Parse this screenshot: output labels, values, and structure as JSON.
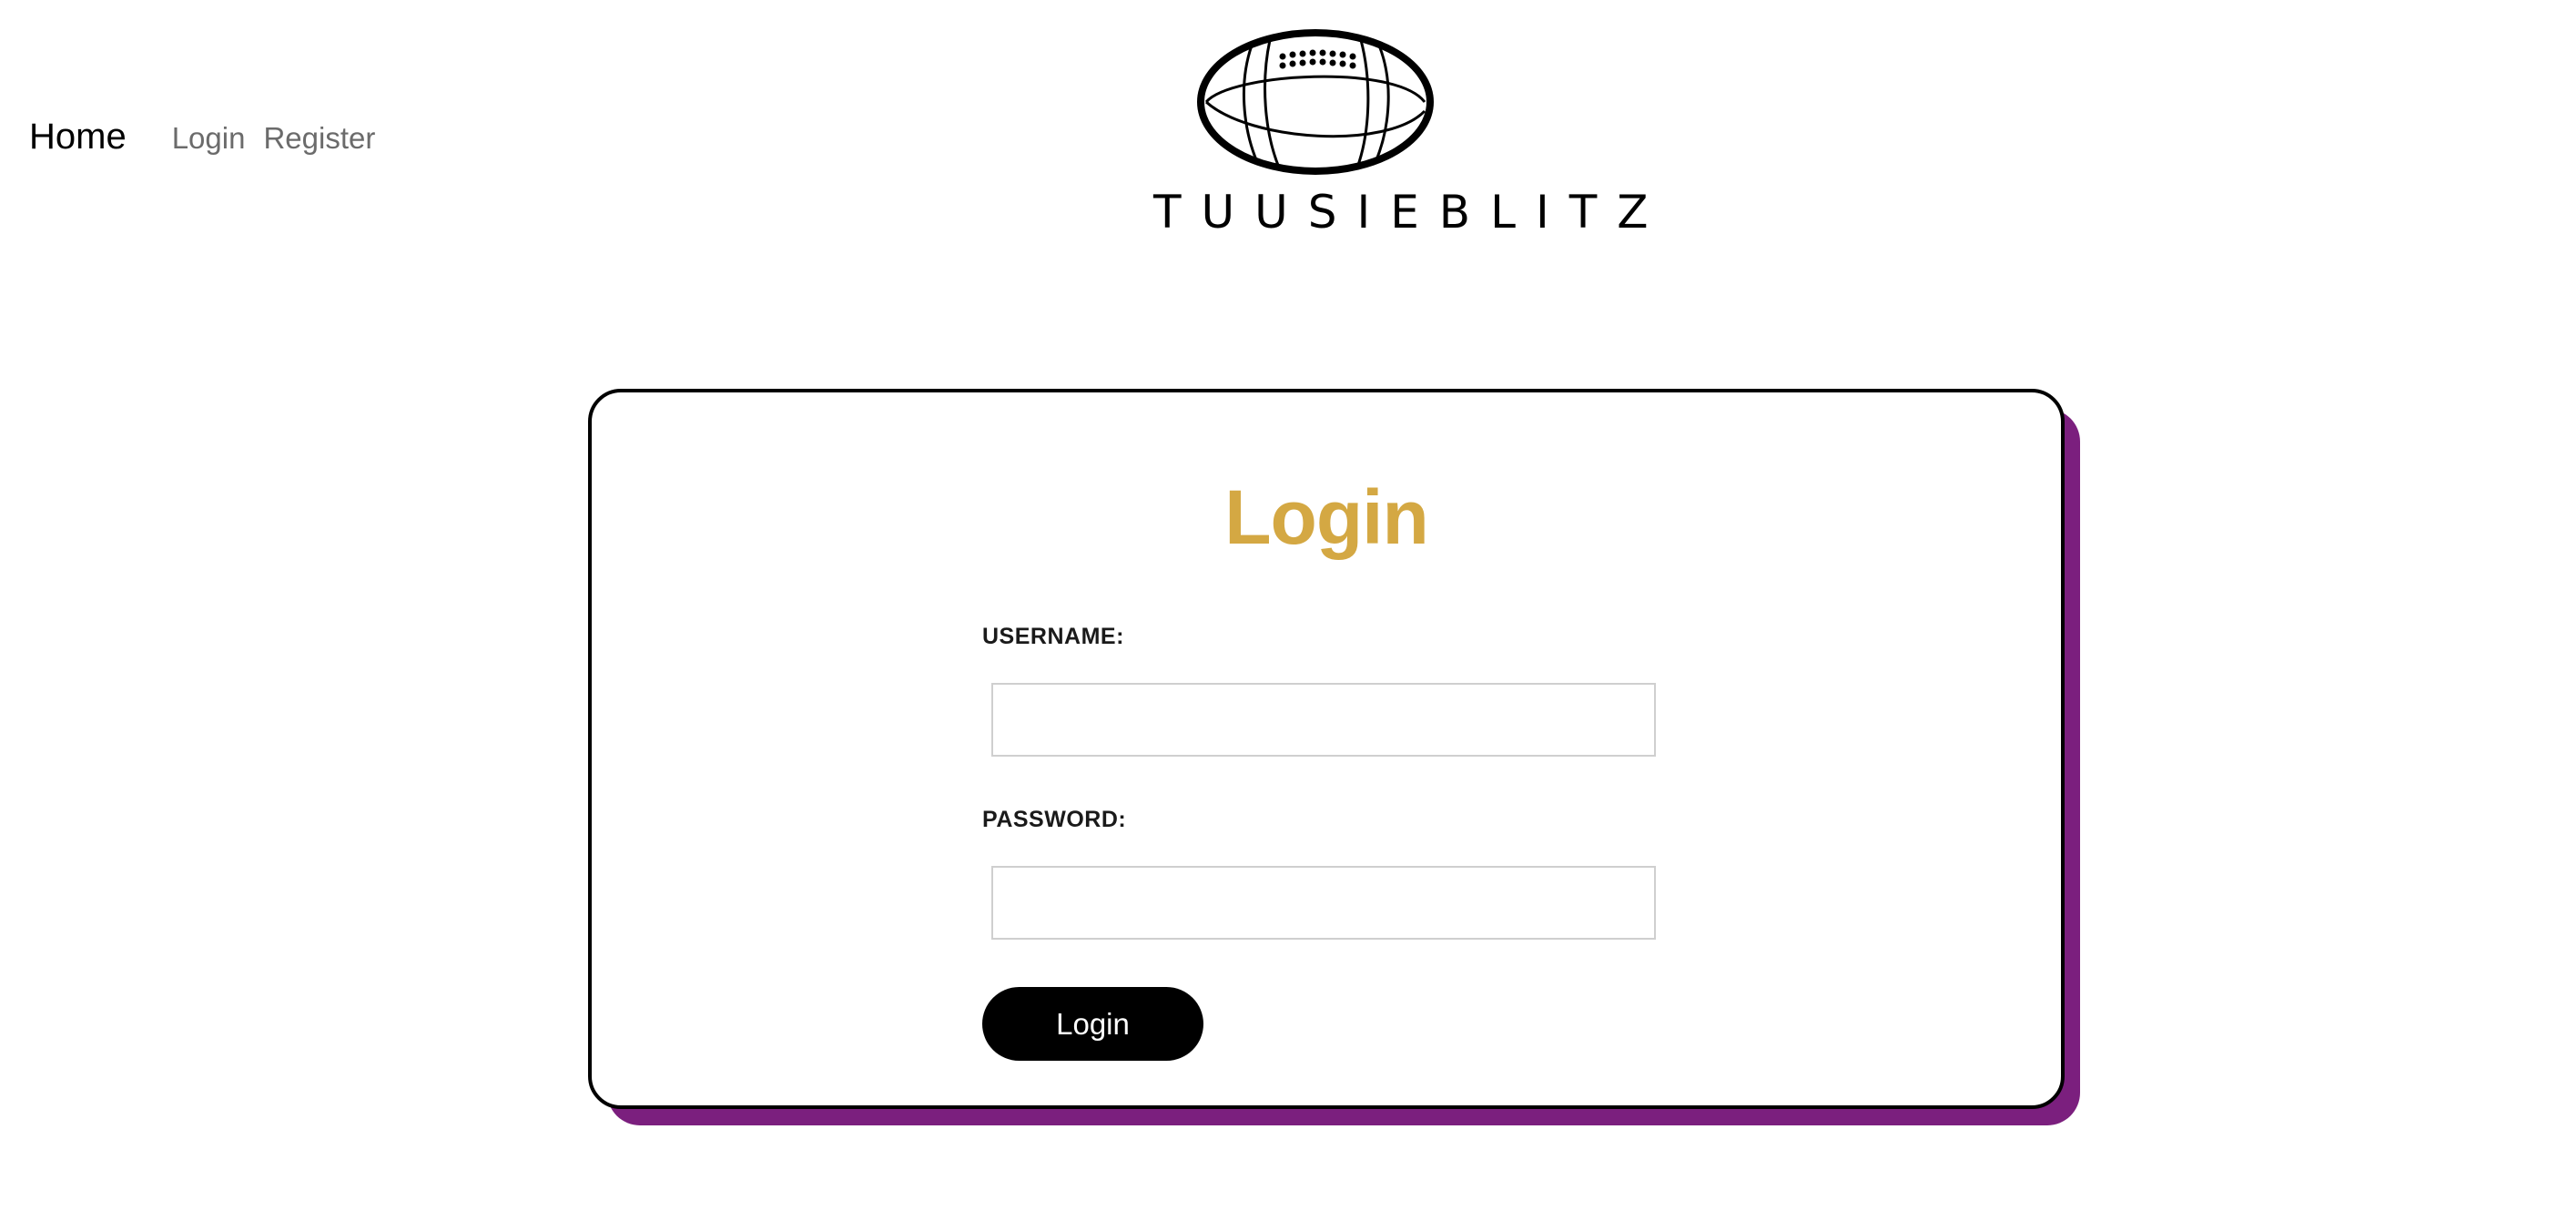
{
  "nav": {
    "home_label": "Home",
    "login_label": "Login",
    "register_label": "Register"
  },
  "brand": {
    "name": "TUUSIEBLITZ",
    "icon": "football-icon"
  },
  "login_form": {
    "title": "Login",
    "username_label": "USERNAME:",
    "username_value": "",
    "password_label": "PASSWORD:",
    "password_value": "",
    "submit_label": "Login"
  },
  "colors": {
    "title_gold": "#d4a843",
    "card_shadow_purple": "#7b1f7e",
    "button_black": "#000000",
    "nav_gray": "#6b6b6b"
  }
}
